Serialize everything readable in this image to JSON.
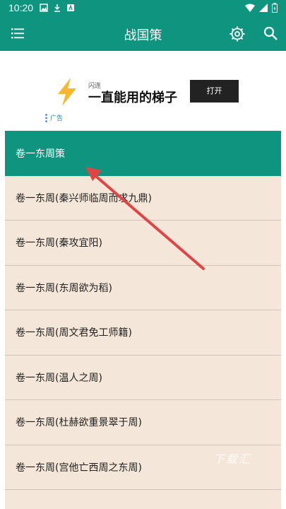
{
  "status_bar": {
    "time": "10:20"
  },
  "app_bar": {
    "title": "战国策"
  },
  "ad": {
    "brand": "闪连",
    "headline": "一直能用的梯子",
    "button_label": "打开",
    "badge_label": "广告"
  },
  "chapters": [
    {
      "label": "卷一东周策"
    },
    {
      "label": "卷一东周(秦兴师临周而求九鼎)"
    },
    {
      "label": "卷一东周(秦攻宜阳)"
    },
    {
      "label": "卷一东周(东周欲为稻)"
    },
    {
      "label": "卷一东周(周文君免工师籍)"
    },
    {
      "label": "卷一东周(温人之周)"
    },
    {
      "label": "卷一东周(杜赫欲重景翠于周)"
    },
    {
      "label": "卷一东周(宫他亡西周之东周)"
    }
  ],
  "watermark": "下载汇",
  "colors": {
    "accent": "#0f9480",
    "list_bg": "#f4e6d8",
    "arrow": "#e04545"
  }
}
